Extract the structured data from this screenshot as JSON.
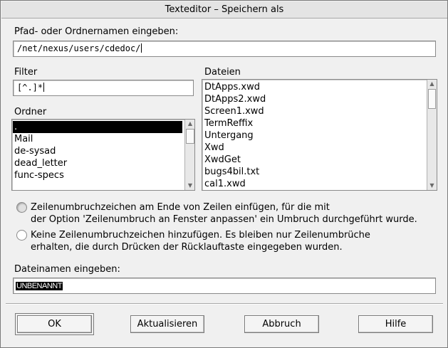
{
  "window": {
    "title": "Texteditor – Speichern als"
  },
  "path": {
    "label": "Pfad- oder Ordnernamen eingeben:",
    "value": "/net/nexus/users/cdedoc/"
  },
  "filter": {
    "label": "Filter",
    "value": "[^.]*"
  },
  "folders": {
    "label": "Ordner",
    "items": [
      ".",
      "Mail",
      "de-sysad",
      "dead_letter",
      "func-specs"
    ],
    "selected_index": 0
  },
  "files": {
    "label": "Dateien",
    "items": [
      "DtApps.xwd",
      "DtApps2.xwd",
      "Screen1.xwd",
      "TermReffix",
      "Untergang",
      "Xwd",
      "XwdGet",
      "bugs4bil.txt",
      "cal1.xwd"
    ]
  },
  "options": {
    "selected_index": 0,
    "items": [
      {
        "line1": "Zeilenumbruchzeichen am Ende von Zeilen einfügen, für die mit",
        "line2": "der Option 'Zeilenumbruch an Fenster anpassen' ein Umbruch durchgeführt wurde."
      },
      {
        "line1": "Keine Zeilenumbruchzeichen hinzufügen. Es bleiben nur Zeilenumbrüche",
        "line2": "erhalten, die durch Drücken der Rücklauftaste eingegeben wurden."
      }
    ]
  },
  "filename": {
    "label": "Dateinamen eingeben:",
    "value": "UNBENANNT"
  },
  "buttons": {
    "ok": "OK",
    "update": "Aktualisieren",
    "cancel": "Abbruch",
    "help": "Hilfe"
  }
}
